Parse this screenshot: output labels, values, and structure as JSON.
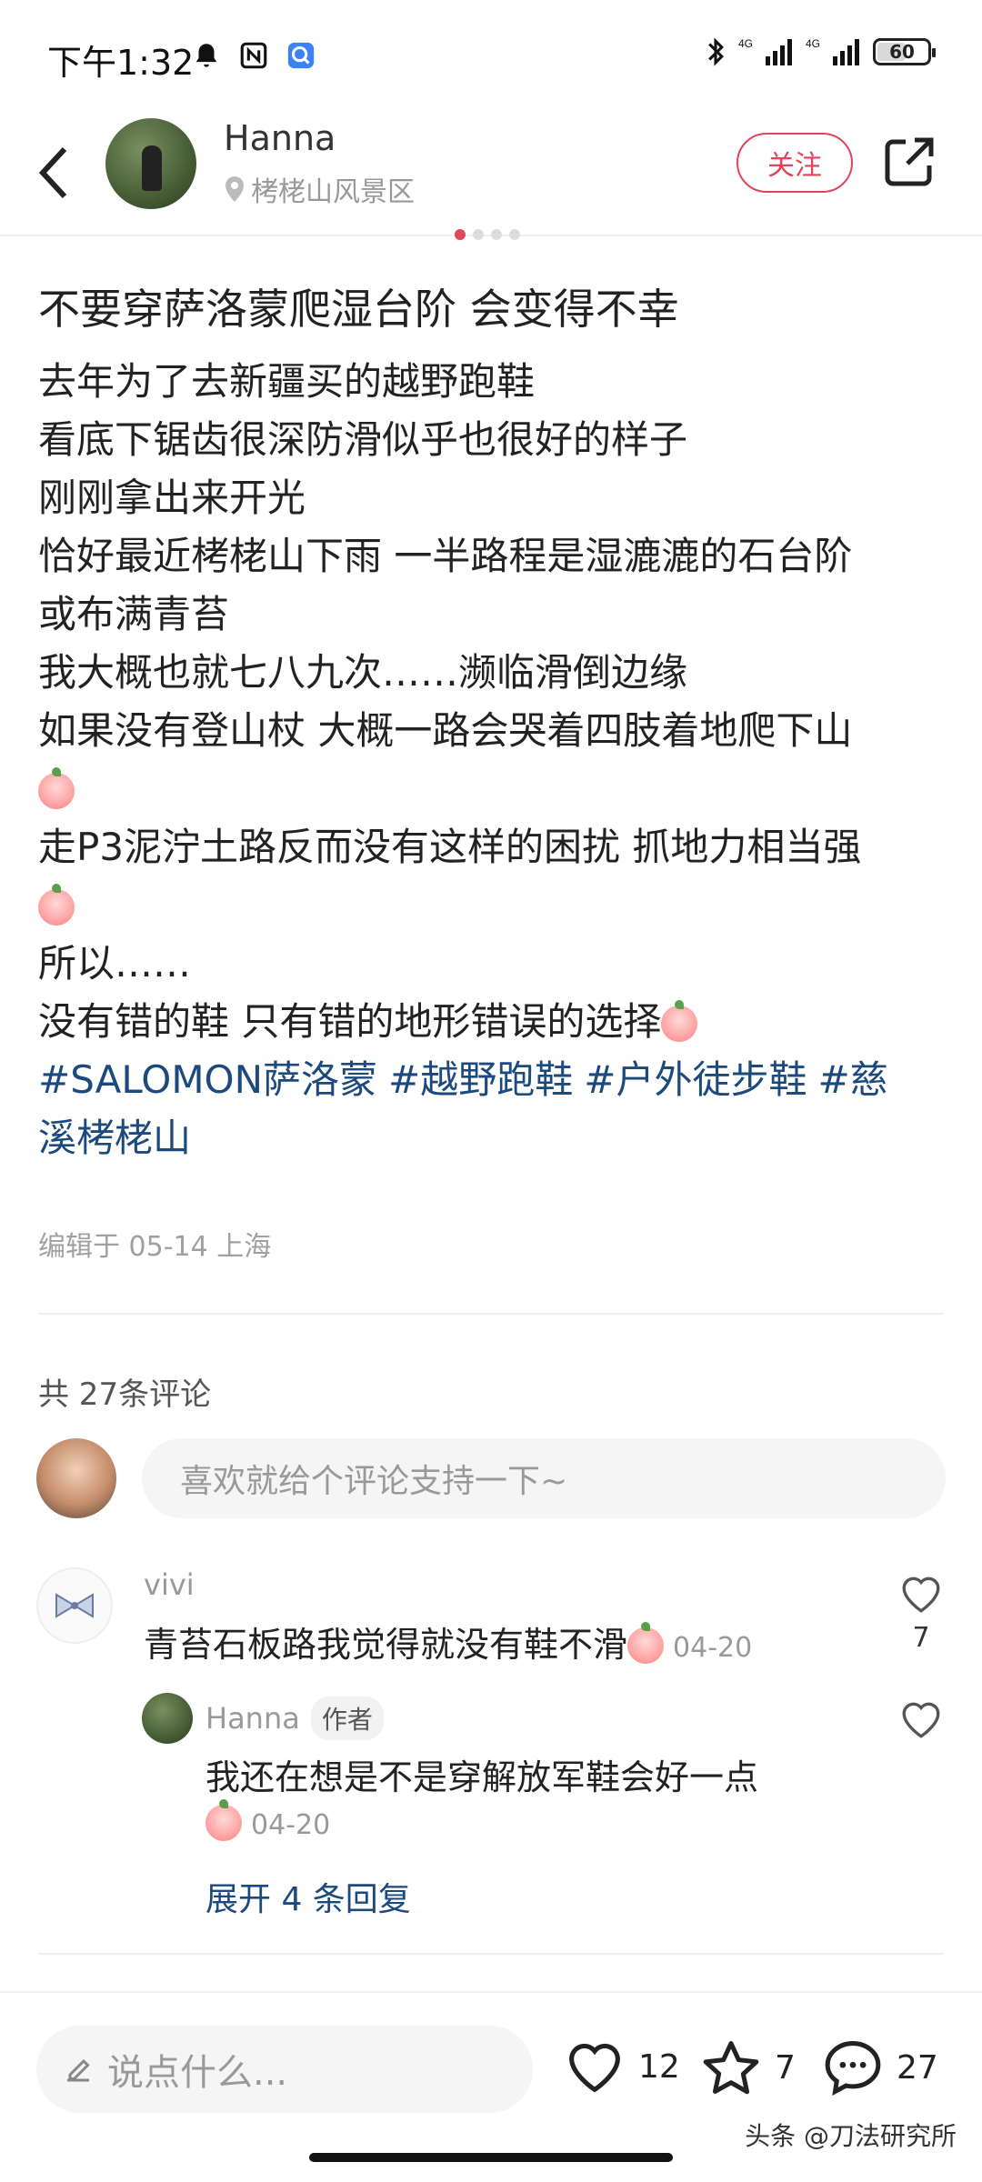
{
  "status_bar": {
    "time": "下午1:32",
    "network": [
      "4G",
      "4G"
    ],
    "battery": "60",
    "battery_level": 0.6
  },
  "header": {
    "author_name": "Hanna",
    "location": "栲栳山风景区",
    "follow_label": "关注"
  },
  "post": {
    "title": "不要穿萨洛蒙爬湿台阶 会变得不幸",
    "lines": [
      "去年为了去新疆买的越野跑鞋",
      "看底下锯齿很深防滑似乎也很好的样子",
      "刚刚拿出来开光",
      "恰好最近栲栳山下雨 一半路程是湿漉漉的石台阶",
      "或布满青苔",
      "我大概也就七八九次……濒临滑倒边缘",
      "如果没有登山杖 大概一路会哭着四肢着地爬下山",
      "走P3泥泞土路反而没有这样的困扰 抓地力相当强",
      "所以……",
      "没有错的鞋 只有错的地形错误的选择"
    ],
    "hashtags": [
      "#SALOMON萨洛蒙",
      "#越野跑鞋",
      "#户外徒步鞋",
      "#慈",
      "溪栲栳山"
    ],
    "edit_info": "编辑于 05-14 上海"
  },
  "comments": {
    "count_label": "共 27条评论",
    "input_placeholder": "喜欢就给个评论支持一下~",
    "items": [
      {
        "name": "vivi",
        "text": "青苔石板路我觉得就没有鞋不滑",
        "date": "04-20",
        "likes": "7"
      },
      {
        "name": "Hanna",
        "badge": "作者",
        "text": "我还在想是不是穿解放军鞋会好一点",
        "date": "04-20"
      }
    ],
    "expand_label": "展开 4 条回复"
  },
  "bottom_bar": {
    "say_placeholder": "说点什么...",
    "likes": "12",
    "favorites": "7",
    "comments": "27"
  },
  "watermark": "头条 @刀法研究所",
  "colors": {
    "accent": "#e0455a",
    "link": "#1d4a7e"
  }
}
